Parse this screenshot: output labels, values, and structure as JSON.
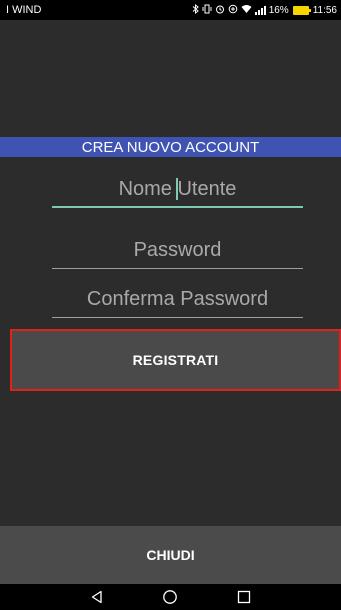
{
  "status_bar": {
    "carrier": "I WIND",
    "battery_percent": "16%",
    "time": "11:56",
    "icons": [
      "bluetooth-icon",
      "vibrate-icon",
      "alarm-icon",
      "data-saver-icon",
      "wifi-icon",
      "signal-icon",
      "battery-charging-icon"
    ],
    "battery_color": "#f5d400"
  },
  "form": {
    "title": "CREA NUOVO ACCOUNT",
    "title_bg_color": "#3f53b3",
    "username": {
      "placeholder_before_cursor": "Nome ",
      "placeholder_after_cursor": "Utente",
      "focused": true,
      "accent_color": "#7fc8b6"
    },
    "password": {
      "placeholder": "Password"
    },
    "confirm_password": {
      "placeholder": "Conferma Password"
    },
    "register_label": "REGISTRATI",
    "register_border_color": "#e0201c"
  },
  "footer": {
    "close_label": "CHIUDI"
  },
  "nav_bar": {
    "buttons": [
      "back-icon",
      "home-icon",
      "recents-icon"
    ]
  }
}
